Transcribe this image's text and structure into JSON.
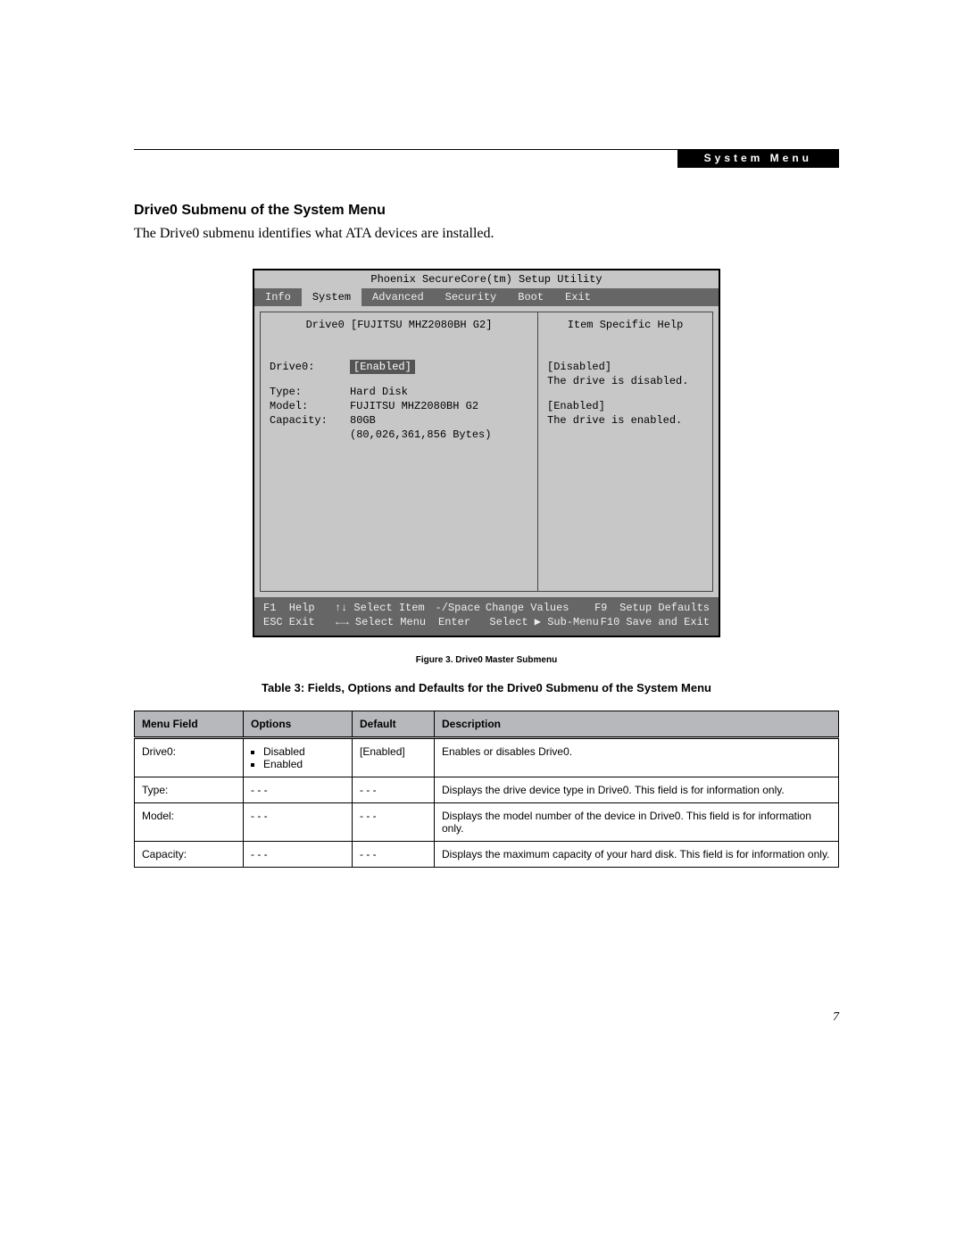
{
  "header": {
    "label": "System Menu"
  },
  "section": {
    "title": "Drive0 Submenu of the System Menu",
    "intro": "The Drive0 submenu identifies what ATA devices are installed."
  },
  "bios": {
    "utility_title": "Phoenix SecureCore(tm) Setup Utility",
    "tabs": [
      "Info",
      "System",
      "Advanced",
      "Security",
      "Boot",
      "Exit"
    ],
    "active_tab": "System",
    "left_title": "Drive0 [FUJITSU MHZ2080BH G2]",
    "right_title": "Item Specific Help",
    "fields": {
      "drive0_label": "Drive0:",
      "drive0_value": "[Enabled]",
      "type_label": "Type:",
      "type_value": "Hard Disk",
      "model_label": "Model:",
      "model_value": "FUJITSU MHZ2080BH G2",
      "capacity_label": "Capacity:",
      "capacity_value": "80GB",
      "capacity_bytes": "(80,026,361,856 Bytes)"
    },
    "help": {
      "l1": "[Disabled]",
      "l2": "The drive is disabled.",
      "l3": "[Enabled]",
      "l4": "The drive is enabled."
    },
    "footer": {
      "row1": {
        "a": "F1  Help",
        "b": "↑↓ Select Item",
        "c": "-/Space",
        "d": "Change Values",
        "e": "F9",
        "f": "Setup Defaults"
      },
      "row2": {
        "a": "ESC Exit",
        "b": "←→ Select Menu",
        "c": "Enter",
        "d": "Select ▶ Sub-Menu",
        "e": "F10",
        "f": "Save and Exit"
      }
    }
  },
  "figure_caption": "Figure 3.  Drive0 Master Submenu",
  "table_title": "Table 3: Fields, Options and Defaults for the Drive0 Submenu of the System Menu",
  "table": {
    "headers": {
      "menu_field": "Menu Field",
      "options": "Options",
      "default": "Default",
      "description": "Description"
    },
    "rows": [
      {
        "menu_field": "Drive0:",
        "options": [
          "Disabled",
          "Enabled"
        ],
        "default": "[Enabled]",
        "description": "Enables or disables Drive0."
      },
      {
        "menu_field": "Type:",
        "options_text": "- - -",
        "default": "- - -",
        "description": "Displays the drive device type in Drive0. This field is for information only."
      },
      {
        "menu_field": "Model:",
        "options_text": "- - -",
        "default": "- - -",
        "description": "Displays the model number of the device in Drive0. This field is for information only."
      },
      {
        "menu_field": "Capacity:",
        "options_text": "- - -",
        "default": "- - -",
        "description": "Displays the maximum capacity of your hard disk. This field is for information only."
      }
    ]
  },
  "page_number": "7"
}
